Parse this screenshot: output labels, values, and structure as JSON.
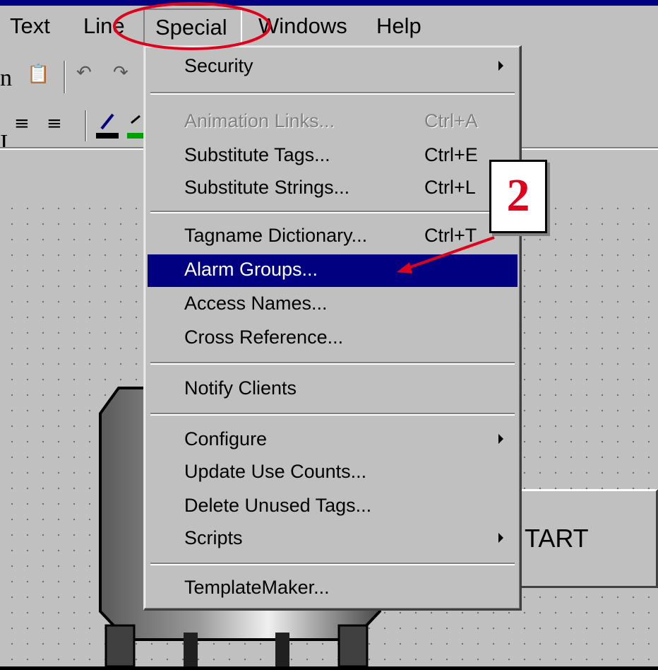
{
  "menubar": {
    "items": [
      {
        "label": "Text"
      },
      {
        "label": "Line"
      },
      {
        "label": "Special"
      },
      {
        "label": "Windows"
      },
      {
        "label": "Help"
      }
    ]
  },
  "background_fragments": {
    "left_top": "n",
    "left_mid": "I"
  },
  "dropdown": {
    "items": [
      {
        "label": "Security",
        "submenu": true
      },
      {
        "label": "Animation Links...",
        "shortcut": "Ctrl+A",
        "disabled": true
      },
      {
        "label": "Substitute Tags...",
        "shortcut": "Ctrl+E"
      },
      {
        "label": "Substitute Strings...",
        "shortcut": "Ctrl+L"
      },
      {
        "label": "Tagname Dictionary...",
        "shortcut": "Ctrl+T"
      },
      {
        "label": "Alarm Groups...",
        "highlighted": true
      },
      {
        "label": "Access Names..."
      },
      {
        "label": "Cross Reference..."
      },
      {
        "label": "Notify Clients"
      },
      {
        "label": "Configure",
        "submenu": true
      },
      {
        "label": "Update Use Counts..."
      },
      {
        "label": "Delete Unused Tags..."
      },
      {
        "label": "Scripts",
        "submenu": true
      },
      {
        "label": "TemplateMaker..."
      }
    ]
  },
  "canvas": {
    "start_button_label": "TART"
  },
  "annotation": {
    "step_number": "2",
    "circle_color": "#e0001b",
    "arrow_color": "#e0001b"
  },
  "colors": {
    "menu_bg": "#c0c0c0",
    "highlight": "#000080",
    "title_bar": "#000080"
  },
  "toolbar_icons": [
    "paste-icon",
    "undo-icon",
    "redo-icon",
    "align-center-icon",
    "align-right-icon",
    "line-color-icon",
    "fill-color-icon"
  ]
}
